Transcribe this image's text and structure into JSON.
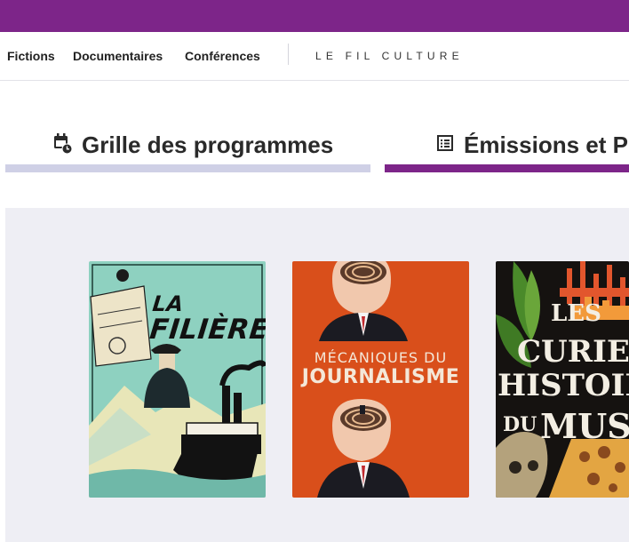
{
  "colors": {
    "brand": "#7d2589",
    "tab_inactive": "#cfd0e6",
    "shelf_background": "#eeeef4"
  },
  "nav": {
    "items": [
      {
        "label": "Fictions"
      },
      {
        "label": "Documentaires"
      },
      {
        "label": "Conférences"
      }
    ],
    "brand_label": "LE FIL CULTURE"
  },
  "tabs": [
    {
      "label": "Grille des programmes",
      "icon": "calendar-clock-icon",
      "active": false
    },
    {
      "label": "Émissions et Po",
      "icon": "list-icon",
      "active": true
    }
  ],
  "podcasts": [
    {
      "title_line1": "LA",
      "title_line2": "FILIÈRE"
    },
    {
      "title_line1": "MÉCANIQUES DU",
      "title_line2": "JOURNALISME"
    },
    {
      "title_lines": [
        "LES",
        "CURIEUS",
        "HISTOIRES",
        "DU",
        "MUSÉU"
      ]
    }
  ]
}
